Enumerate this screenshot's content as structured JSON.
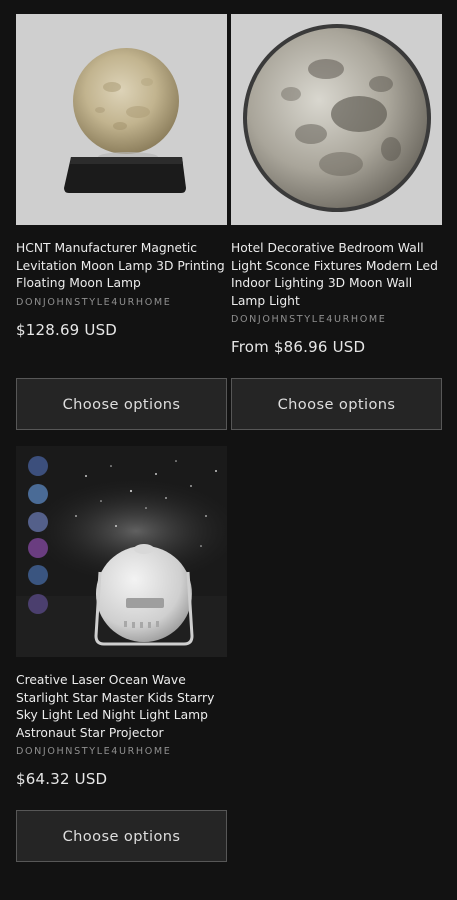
{
  "products": [
    {
      "title": "HCNT Manufacturer Magnetic Levitation Moon Lamp 3D Printing Floating Moon Lamp",
      "vendor": "DONJOHNSTYLE4URHOME",
      "price": "$128.69 USD",
      "button_label": "Choose options",
      "image_icon": "moon-lamp-image"
    },
    {
      "title": "Hotel Decorative Bedroom Wall Light Sconce Fixtures Modern Led Indoor Lighting 3D Moon Wall Lamp Light",
      "vendor": "DONJOHNSTYLE4URHOME",
      "price": "From $86.96 USD",
      "button_label": "Choose options",
      "image_icon": "moon-wall-lamp-image"
    },
    {
      "title": "Creative Laser Ocean Wave Starlight Star Master Kids Starry Sky Light Led Night Light Lamp Astronaut Star Projector",
      "vendor": "DONJOHNSTYLE4URHOME",
      "price": "$64.32 USD",
      "button_label": "Choose options",
      "image_icon": "star-projector-image"
    }
  ],
  "colors": {
    "background": "#121212",
    "button_bg": "#252525",
    "button_border": "#575757",
    "vendor_text": "#8f8f8f"
  }
}
